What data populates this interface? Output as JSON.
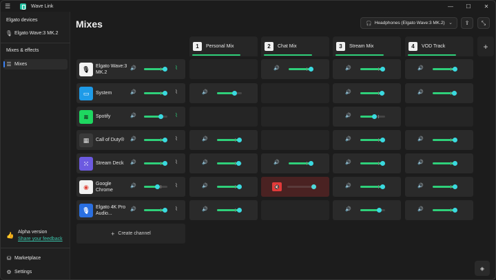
{
  "app": {
    "title": "Wave Link",
    "menu_icon": "hamburger-icon",
    "logo_icon": "wave-link-logo-icon"
  },
  "window_controls": {
    "minimize": "—",
    "maximize": "☐",
    "close": "✕"
  },
  "sidebar": {
    "devices_heading": "Elgato devices",
    "device": {
      "label": "Elgato Wave:3 MK.2",
      "icon": "microphone-icon"
    },
    "mixes_heading": "Mixes & effects",
    "mixes_item": {
      "label": "Mixes",
      "icon": "sliders-icon"
    },
    "feedback": {
      "title": "Alpha version",
      "link": "Share your feedback",
      "icon": "thumbs-up-icon"
    },
    "marketplace": {
      "label": "Marketplace",
      "icon": "marketplace-icon"
    },
    "settings": {
      "label": "Settings",
      "icon": "gear-icon"
    }
  },
  "header": {
    "title": "Mixes",
    "output_device": "Headphones (Elgato Wave:3 MK.2)",
    "output_icon": "headphones-icon"
  },
  "mixes": [
    {
      "number": "1",
      "label": "Personal Mix"
    },
    {
      "number": "2",
      "label": "Chat Mix"
    },
    {
      "number": "3",
      "label": "Stream Mix"
    },
    {
      "number": "4",
      "label": "VOD Track"
    }
  ],
  "channels": [
    {
      "name": "Elgato Wave:3 MK.2",
      "icon": "microphone-icon",
      "icon_color": "#f2f2f2",
      "level": 0.95,
      "cells": [
        "empty",
        0.9,
        0.9,
        0.9
      ]
    },
    {
      "name": "System",
      "icon": "monitor-icon",
      "icon_color": "#1e9be8",
      "level": 0.95,
      "cells": [
        0.7,
        "empty",
        0.85,
        0.85
      ]
    },
    {
      "name": "Spotify",
      "icon": "spotify-icon",
      "icon_color": "#1ed760",
      "level": 0.7,
      "cells": [
        "empty",
        "empty",
        0.55,
        "empty"
      ]
    },
    {
      "name": "Call of Duty®",
      "icon": "call-of-duty-icon",
      "icon_color": "#3a3a3a",
      "level": 0.95,
      "cells": [
        0.95,
        "empty",
        0.95,
        0.95
      ]
    },
    {
      "name": "Stream Deck",
      "icon": "stream-deck-icon",
      "icon_color": "#6c5ae0",
      "level": 0.95,
      "cells": [
        0.85,
        0.9,
        0.95,
        0.95
      ]
    },
    {
      "name": "Google Chrome",
      "icon": "chrome-icon",
      "icon_color": "#f2f2f2",
      "level": 0.55,
      "cells": [
        0.95,
        "muted",
        0.95,
        0.95
      ]
    },
    {
      "name": "Elgato 4K Pro Audio...",
      "icon": "elgato-4k-icon",
      "icon_color": "#2a6fe0",
      "level": 0.95,
      "cells": [
        0.95,
        "empty",
        0.75,
        0.95
      ]
    }
  ],
  "create_channel": "Create channel",
  "colors": {
    "accent_green": "#2fd07a",
    "knob": "#3ad9e0",
    "link": "#3bc4ab",
    "mute_red": "#e23a3a"
  }
}
